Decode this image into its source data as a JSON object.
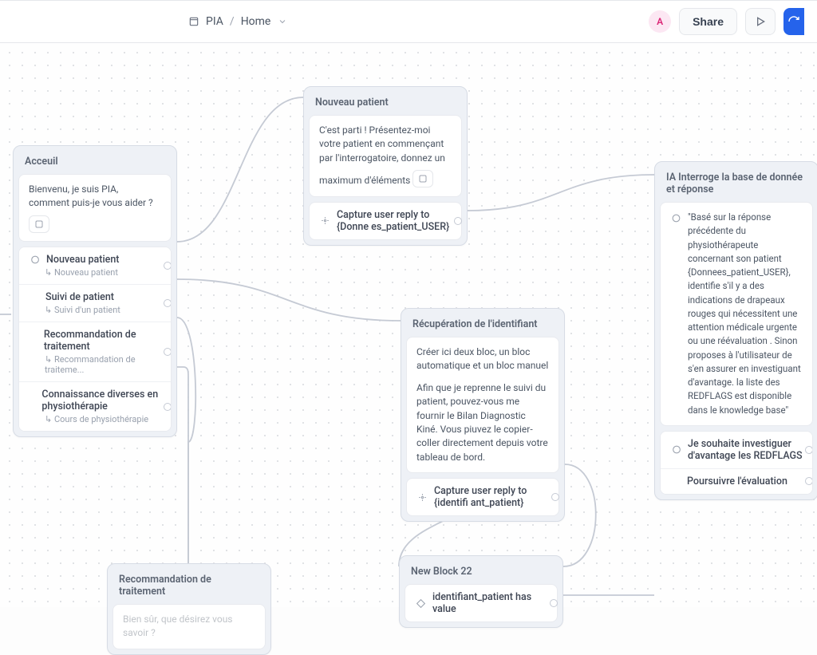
{
  "header": {
    "app_name": "PIA",
    "page": "Home",
    "avatar_letter": "A",
    "share_label": "Share"
  },
  "nodes": {
    "accueil": {
      "title": "Acceuil",
      "greeting": "Bienvenu, je suis PIA, comment puis-je vous aider ?",
      "items": [
        {
          "label": "Nouveau patient",
          "sub": "Nouveau patient"
        },
        {
          "label": "Suivi de patient",
          "sub": "Suivi d'un patient"
        },
        {
          "label": "Recommandation de traitement",
          "sub": "Recommandation de traiteme..."
        },
        {
          "label": "Connaissance diverses en physiothérapie",
          "sub": "Cours de physiothérapie"
        }
      ]
    },
    "nouveau": {
      "title": "Nouveau patient",
      "body": "C'est parti ! Présentez-moi votre patient en commençant par l'interrogatoire, donnez un maximum d'éléments",
      "capture": "Capture user reply to {Donne es_patient_USER}"
    },
    "recup": {
      "title": "Récupération de l'identifiant",
      "body1": "Créer ici deux bloc, un bloc automatique et un bloc manuel",
      "body2": "Afin que je reprenne le suivi du patient, pouvez-vous me fournir le Bilan Diagnostic Kiné. Vous piuvez le copier-coller directement depuis votre tableau de bord.",
      "capture": "Capture user reply to {identifi ant_patient}"
    },
    "ia": {
      "title": "IA Interroge la base de donnée et réponse",
      "quote": "\"Basé sur la réponse précédente du physiothérapeute concernant son patient {Donnees_patient_USER}, identifie s'il y a des indications de drapeaux rouges qui nécessitent une attention médicale urgente ou une réévaluation . Sinon proposes à l'utilisateur de s'en assurer en investiguant d'avantage. la liste des REDFLAGS est disponible dans le knowledge base\"",
      "option1": "Je souhaite investiguer d'avantage les REDFLAGS",
      "option2": "Poursuivre l'évaluation"
    },
    "recom": {
      "title": "Recommandation de traitement",
      "body": "Bien sûr, que désirez vous savoir ?"
    },
    "block22": {
      "title": "New Block 22",
      "cond": "identifiant_patient has value"
    }
  }
}
